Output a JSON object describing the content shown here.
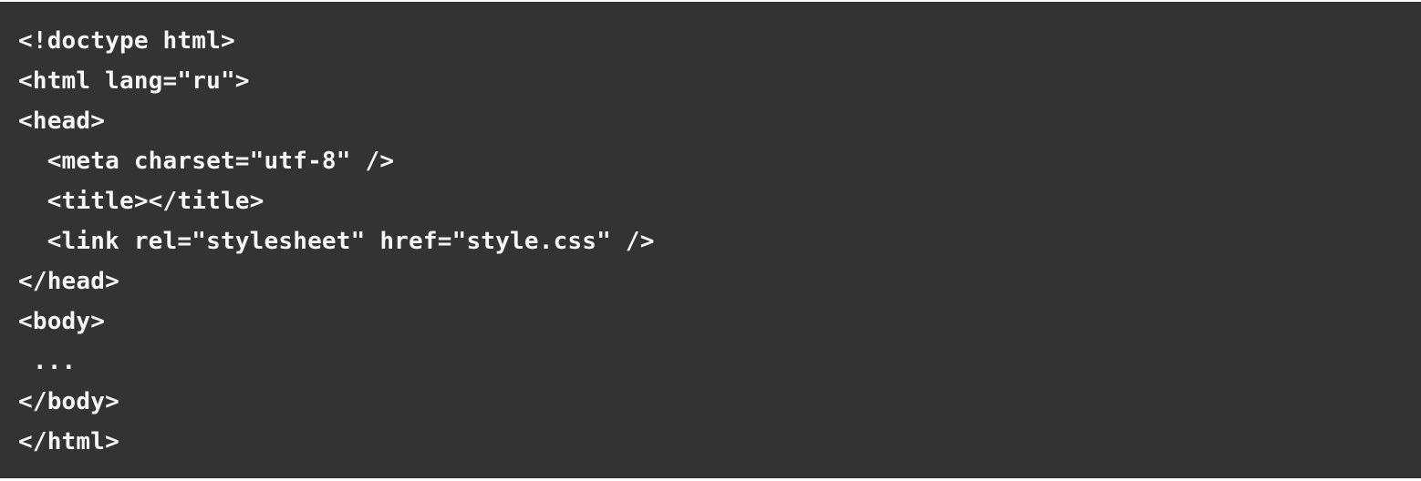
{
  "code_block": {
    "background": "#333333",
    "text_color": "#f5f5f5",
    "lines": [
      "<!doctype html>",
      "<html lang=\"ru\">",
      "<head>",
      "  <meta charset=\"utf-8\" />",
      "  <title></title>",
      "  <link rel=\"stylesheet\" href=\"style.css\" />",
      "</head>",
      "<body>",
      " ...",
      "</body>",
      "</html>"
    ]
  }
}
